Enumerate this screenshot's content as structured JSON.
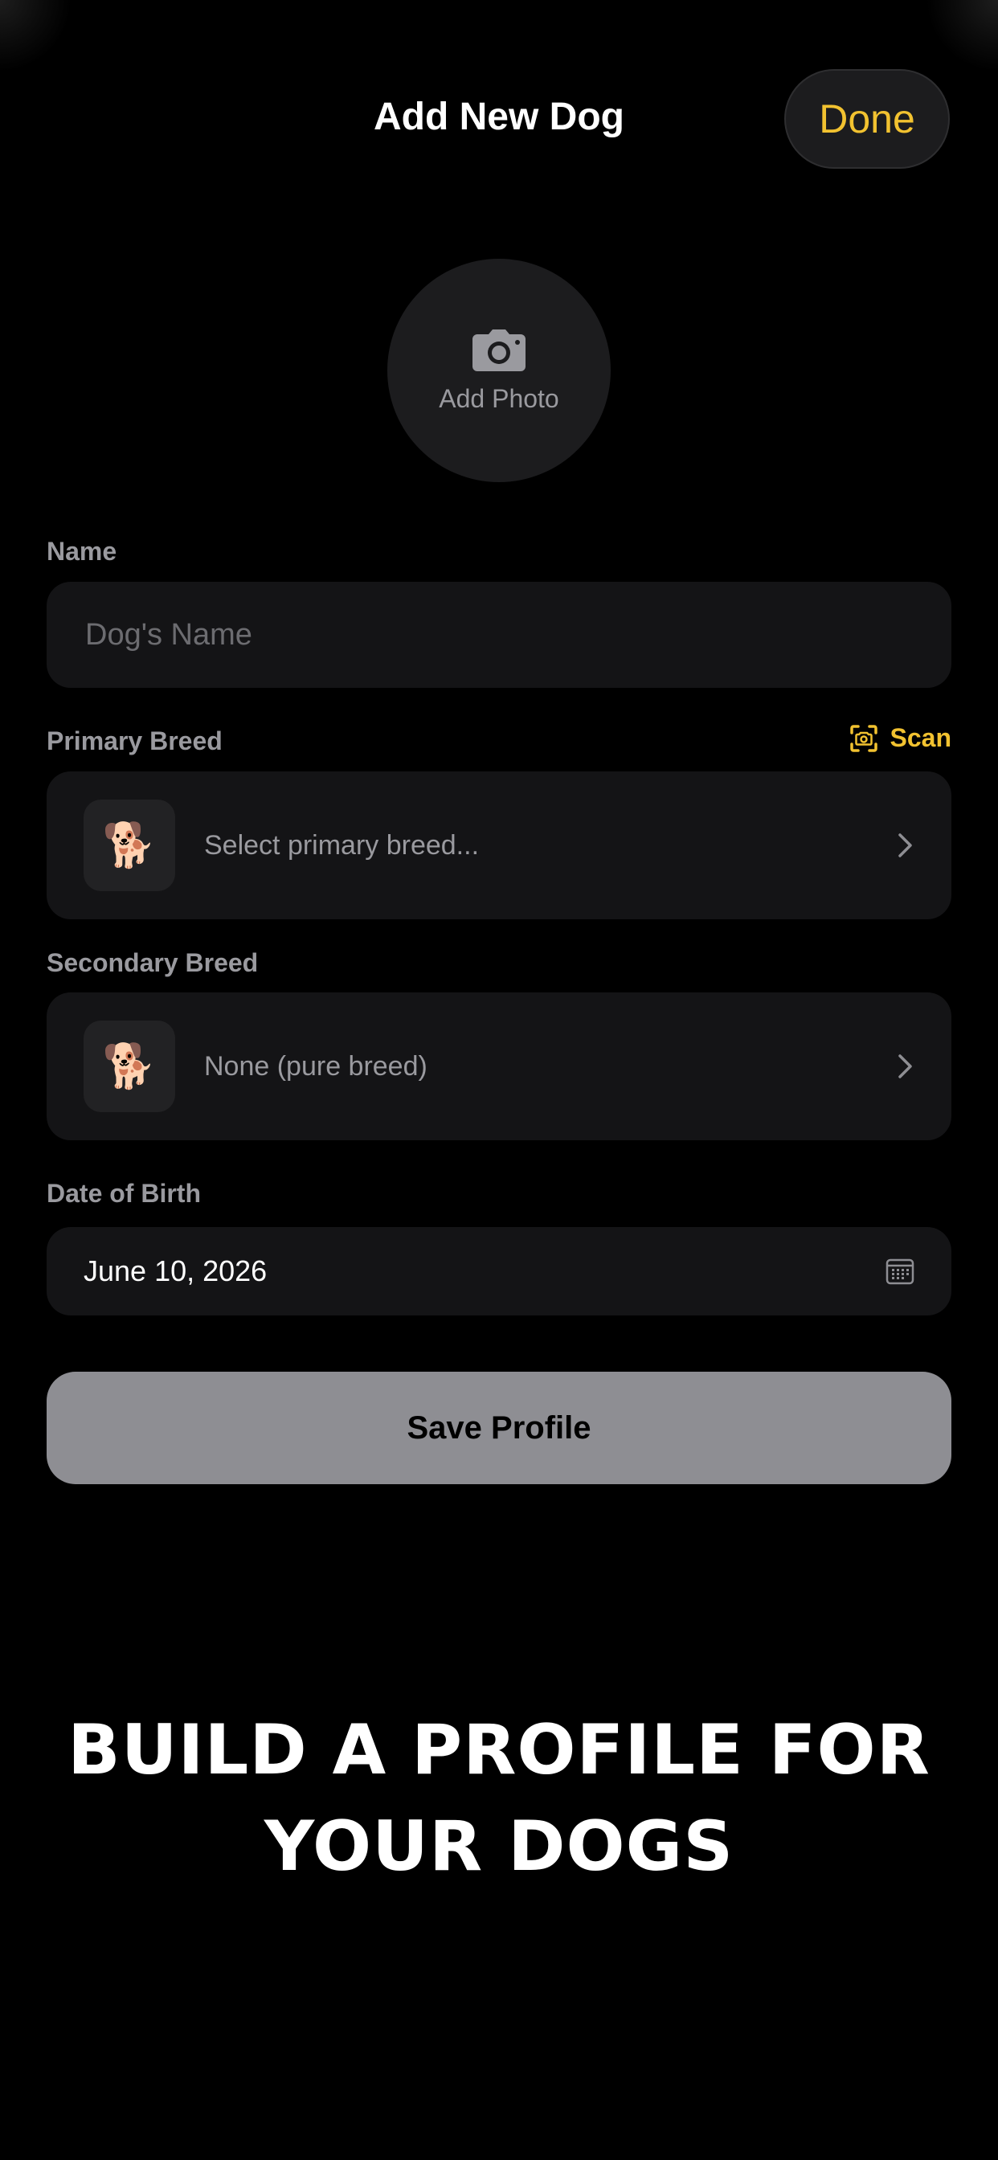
{
  "header": {
    "title": "Add New Dog",
    "done_label": "Done"
  },
  "photo": {
    "label": "Add Photo",
    "icon": "camera-icon"
  },
  "name_field": {
    "label": "Name",
    "placeholder": "Dog's Name",
    "value": ""
  },
  "primary_breed": {
    "label": "Primary Breed",
    "scan_label": "Scan",
    "scan_icon": "scan-camera-icon",
    "thumb_icon": "dog-icon",
    "thumb_glyph": "🐕",
    "value": "Select primary breed..."
  },
  "secondary_breed": {
    "label": "Secondary Breed",
    "thumb_icon": "dog-icon",
    "thumb_glyph": "🐕",
    "value": "None (pure breed)"
  },
  "date_of_birth": {
    "label": "Date of Birth",
    "value": "June 10, 2026",
    "icon": "calendar-icon"
  },
  "save_label": "Save Profile",
  "promo": {
    "line1": "BUILD A PROFILE FOR",
    "line2": "YOUR DOGS"
  },
  "colors": {
    "accent": "#f2c230",
    "background": "#000000",
    "field_background": "#141416",
    "label_text": "#9a9a9f",
    "save_button": "#8e8e93"
  }
}
